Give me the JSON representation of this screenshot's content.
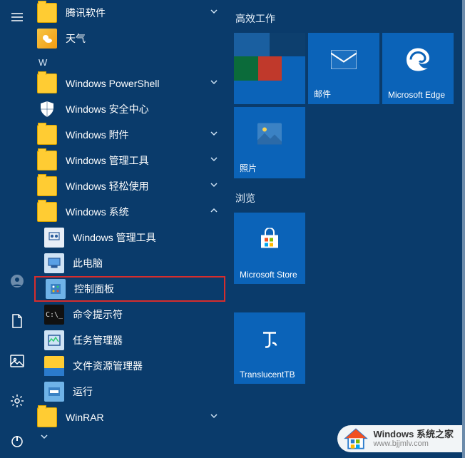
{
  "rail": {
    "hamburger": "≡"
  },
  "app_list": {
    "items": [
      {
        "label": "腾讯软件",
        "icon": "folder",
        "expandable": true
      },
      {
        "label": "天气",
        "icon": "weather",
        "expandable": false
      }
    ],
    "section_letter": "W",
    "w_items": [
      {
        "label": "Windows PowerShell",
        "icon": "folder",
        "expandable": true
      },
      {
        "label": "Windows 安全中心",
        "icon": "shield",
        "expandable": false
      },
      {
        "label": "Windows 附件",
        "icon": "folder",
        "expandable": true
      },
      {
        "label": "Windows 管理工具",
        "icon": "folder",
        "expandable": true
      },
      {
        "label": "Windows 轻松使用",
        "icon": "folder",
        "expandable": true
      },
      {
        "label": "Windows 系统",
        "icon": "folder",
        "expandable": true,
        "expanded": true,
        "children": [
          {
            "label": "Windows 管理工具",
            "icon": "admin-tools"
          },
          {
            "label": "此电脑",
            "icon": "this-pc"
          },
          {
            "label": "控制面板",
            "icon": "control-panel",
            "highlighted": true
          },
          {
            "label": "命令提示符",
            "icon": "cmd"
          },
          {
            "label": "任务管理器",
            "icon": "task-manager"
          },
          {
            "label": "文件资源管理器",
            "icon": "file-explorer"
          },
          {
            "label": "运行",
            "icon": "run"
          }
        ]
      },
      {
        "label": "WinRAR",
        "icon": "folder",
        "expandable": true
      }
    ]
  },
  "tile_groups": [
    {
      "title": "高效工作",
      "tiles": [
        {
          "type": "quad",
          "colors": [
            "#1a5fa0",
            "#0d3f6e",
            "#0b6b3a",
            "#c0392b"
          ]
        },
        {
          "type": "app",
          "label": "邮件",
          "icon": "mail",
          "bg": "#0b63b8"
        },
        {
          "type": "app",
          "label": "Microsoft Edge",
          "icon": "edge",
          "bg": "#0b63b8"
        },
        {
          "type": "app",
          "label": "照片",
          "icon": "photos",
          "bg": "#0b63b8"
        }
      ]
    },
    {
      "title": "浏览",
      "tiles": [
        {
          "type": "app",
          "label": "Microsoft Store",
          "icon": "store",
          "bg": "#0b63b8"
        }
      ]
    },
    {
      "title": "",
      "tiles": [
        {
          "type": "app",
          "label": "TranslucentTB",
          "icon": "translucent-tb",
          "bg": "#0b63b8"
        }
      ]
    }
  ],
  "watermark": {
    "line1": "Windows 系统之家",
    "line2": "www.bjjmlv.com"
  },
  "colors": {
    "bg": "#0a3b6b",
    "tile": "#0b63b8",
    "highlight": "#d62d2d"
  }
}
